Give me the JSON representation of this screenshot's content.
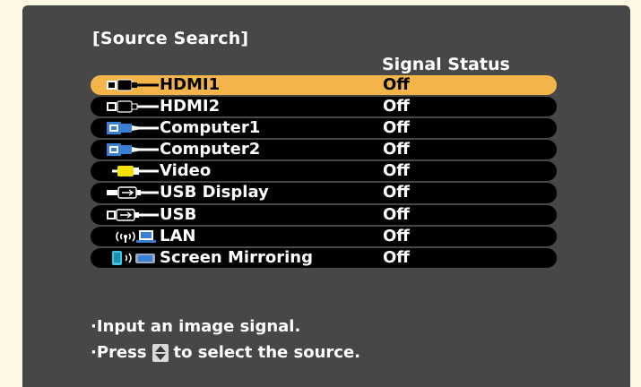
{
  "menu": {
    "title": "[Source Search]",
    "column_header": "Signal Status"
  },
  "sources": [
    {
      "label": "HDMI1",
      "status": "Off",
      "icon": "hdmi-cable-icon",
      "selected": true
    },
    {
      "label": "HDMI2",
      "status": "Off",
      "icon": "hdmi-cable-icon",
      "selected": false
    },
    {
      "label": "Computer1",
      "status": "Off",
      "icon": "vga-cable-icon",
      "selected": false
    },
    {
      "label": "Computer2",
      "status": "Off",
      "icon": "vga-cable-icon",
      "selected": false
    },
    {
      "label": "Video",
      "status": "Off",
      "icon": "rca-video-cable-icon",
      "selected": false
    },
    {
      "label": "USB Display",
      "status": "Off",
      "icon": "usb-cable-icon",
      "selected": false
    },
    {
      "label": "USB",
      "status": "Off",
      "icon": "usb-device-icon",
      "selected": false
    },
    {
      "label": "LAN",
      "status": "Off",
      "icon": "wireless-lan-icon",
      "selected": false
    },
    {
      "label": "Screen Mirroring",
      "status": "Off",
      "icon": "screen-mirroring-icon",
      "selected": false
    }
  ],
  "help": {
    "line1": "·Input an image signal.",
    "line2_prefix": "·Press",
    "line2_suffix": "to select the source.",
    "key_icon": "up-down-arrow-icon"
  },
  "colors": {
    "background": "#fdf8e3",
    "panel": "#474747",
    "row": "#000000",
    "selected_row": "#f3b44a",
    "text": "#ffffff"
  }
}
